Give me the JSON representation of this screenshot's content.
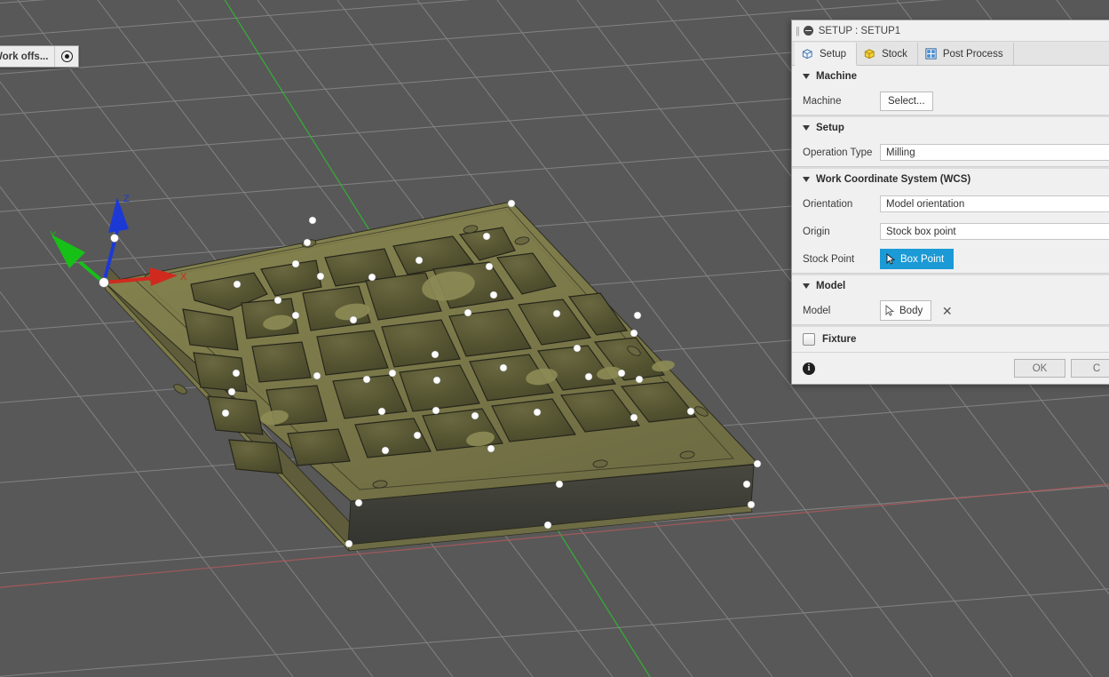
{
  "viewport": {
    "background_color": "#585858",
    "grid_line_color": "#9d9d9d",
    "axis_y_color": "#2fbf2f",
    "axis_x_color": "#b5585c",
    "model": {
      "top_face_color": "#7d7b4c",
      "side_face_color": "#3f3f3f",
      "pocket_color": "#5b5a37",
      "pocket_floor_color": "#8d8b55",
      "edge_color": "#2a2a1e",
      "vertex_point_color": "#ffffff"
    },
    "triad": {
      "x_label": "X",
      "y_label": "Y",
      "z_label": "Z",
      "x_color": "#d02a1e",
      "y_color": "#17c017",
      "z_color": "#1c39d6",
      "origin_color": "#ffffff"
    }
  },
  "work_offsets_chip": {
    "label": "Work offs...",
    "icon": "target-icon"
  },
  "panel": {
    "title": "SETUP : SETUP1",
    "collapse_icon": "collapse-minus-icon",
    "grip_icon": "grip-icon",
    "tabs": [
      {
        "label": "Setup",
        "icon": "setup-cube-icon",
        "active": true
      },
      {
        "label": "Stock",
        "icon": "stock-cube-icon",
        "active": false
      },
      {
        "label": "Post Process",
        "icon": "gcode-g1g2-icon",
        "active": false
      }
    ],
    "sections": {
      "machine": {
        "header": "Machine",
        "machine_label": "Machine",
        "select_button": "Select..."
      },
      "setup": {
        "header": "Setup",
        "operation_type_label": "Operation Type",
        "operation_type_value": "Milling"
      },
      "wcs": {
        "header": "Work Coordinate System (WCS)",
        "orientation_label": "Orientation",
        "orientation_value": "Model orientation",
        "origin_label": "Origin",
        "origin_value": "Stock box point",
        "stock_point_label": "Stock Point",
        "stock_point_button": "Box Point",
        "stock_point_button_color": "#1b9ad6",
        "stock_point_icon": "cursor-arrow-icon"
      },
      "model": {
        "header": "Model",
        "model_label": "Model",
        "model_button": "Body",
        "model_icon": "cursor-arrow-icon",
        "clear_icon": "close-x-icon"
      },
      "fixture": {
        "label": "Fixture",
        "checked": false
      }
    },
    "footer": {
      "info_icon": "info-icon",
      "ok_button": "OK",
      "cancel_button": "C"
    }
  }
}
